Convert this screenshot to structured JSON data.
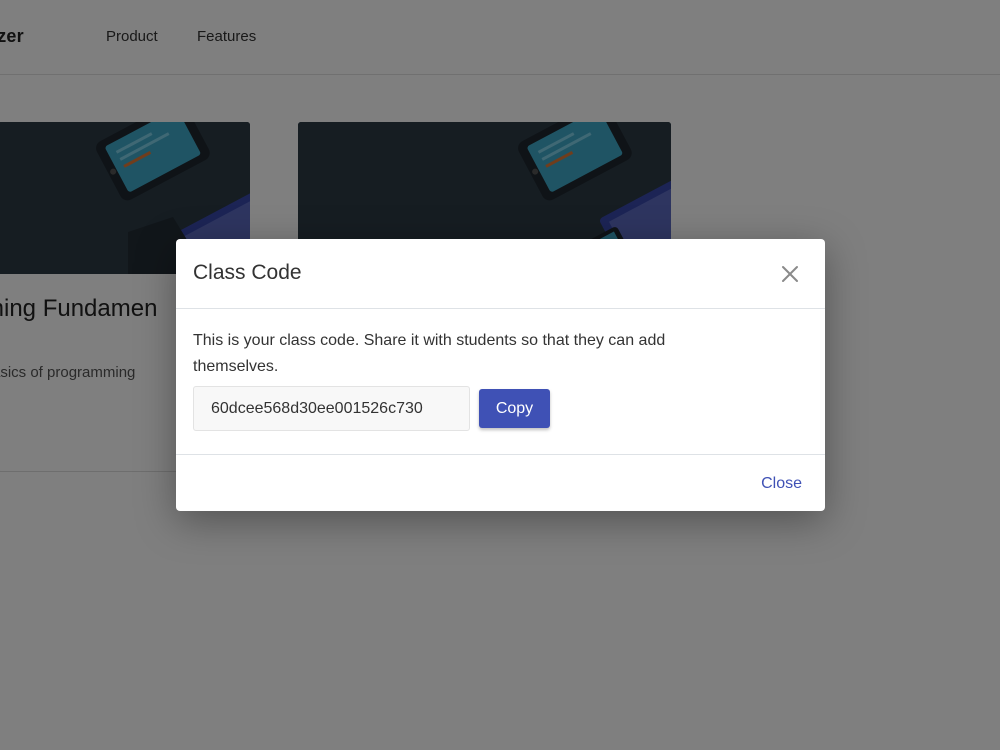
{
  "header": {
    "brand": "izer",
    "nav": [
      {
        "label": "Product"
      },
      {
        "label": "Features"
      }
    ]
  },
  "cards": [
    {
      "title": "ming Fundamen",
      "description": "asics of programming"
    },
    {
      "title": "",
      "description": ""
    }
  ],
  "modal": {
    "title": "Class Code",
    "body_text": "This is your class code. Share it with students so that they can add themselves.",
    "code_value": "60dcee568d30ee001526c730",
    "copy_label": "Copy",
    "close_label": "Close"
  },
  "colors": {
    "accent": "#3f51b5",
    "overlay": "rgba(0,0,0,0.5)",
    "card_media": "#2c3a45"
  },
  "icons": {
    "modal_close": "close-icon"
  }
}
